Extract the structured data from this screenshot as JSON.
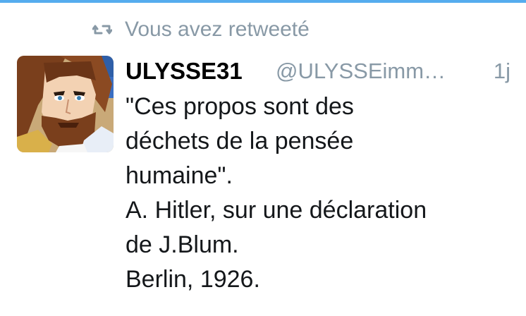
{
  "retweet_context": {
    "icon": "retweet-icon",
    "text": "Vous avez retweeté"
  },
  "tweet": {
    "avatar": "cartoon-bearded-man-avatar",
    "display_name": "ULYSSE31",
    "handle": "@ULYSSEimm…",
    "timestamp": "1j",
    "text_lines": [
      "\"Ces propos sont des",
      "déchets de la pensée",
      "humaine\".",
      "A. Hitler, sur une déclaration",
      "de J.Blum.",
      "Berlin, 1926."
    ]
  },
  "colors": {
    "accent": "#55acee",
    "secondary_text": "#8899a6",
    "primary_text": "#14171a"
  }
}
